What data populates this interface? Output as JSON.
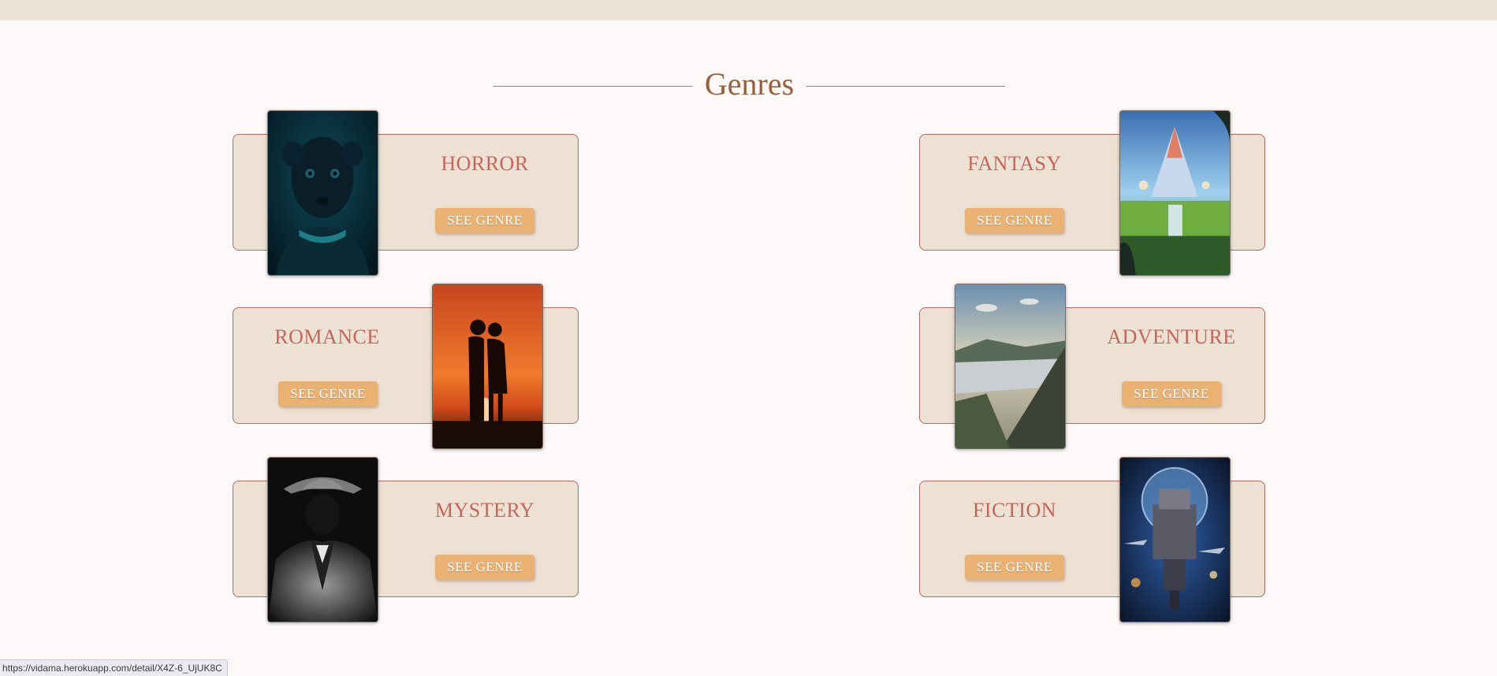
{
  "page": {
    "heading": "Genres",
    "status_url": "https://vidama.herokuapp.com/detail/X4Z-6_UjUK8C"
  },
  "genres": [
    {
      "title": "HORROR",
      "button": "SEE GENRE",
      "image": "horror-poster"
    },
    {
      "title": "FANTASY",
      "button": "SEE GENRE",
      "image": "fantasy-poster"
    },
    {
      "title": "ROMANCE",
      "button": "SEE GENRE",
      "image": "romance-poster"
    },
    {
      "title": "ADVENTURE",
      "button": "SEE GENRE",
      "image": "adventure-poster"
    },
    {
      "title": "MYSTERY",
      "button": "SEE GENRE",
      "image": "mystery-poster"
    },
    {
      "title": "FICTION",
      "button": "SEE GENRE",
      "image": "fiction-poster"
    }
  ],
  "colors": {
    "page_bg": "#fdf9f8",
    "card_bg": "#ede1d4",
    "card_border": "#b06a62",
    "title": "#c8655a",
    "heading": "#9b5f3d",
    "button": "#e9b273"
  }
}
